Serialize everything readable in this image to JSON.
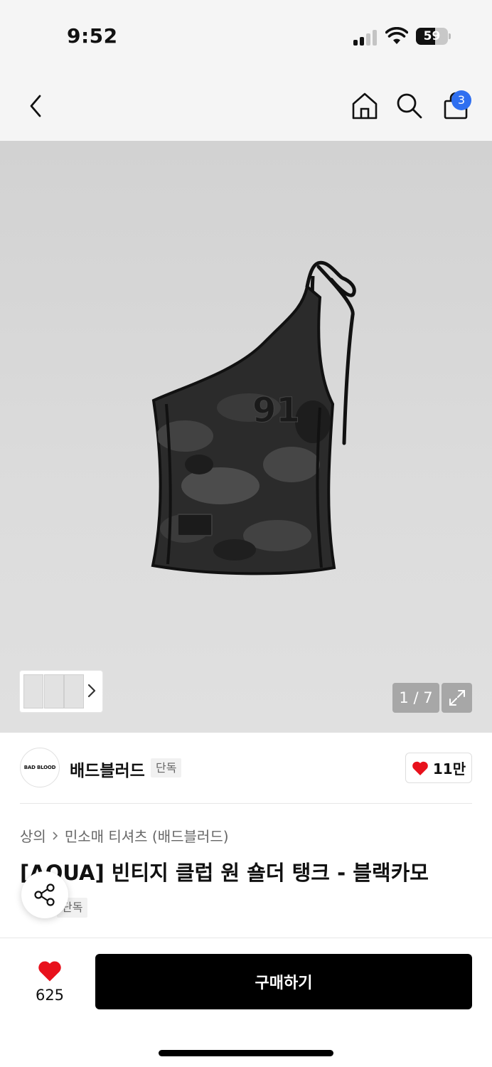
{
  "status": {
    "time": "9:52",
    "battery": "59",
    "battery_level": 0.59
  },
  "nav": {
    "cart_count": "3"
  },
  "gallery": {
    "counter": "1 / 7"
  },
  "brand": {
    "logo_text": "BAD BLOOD",
    "name": "배드블러드",
    "tag": "단독",
    "likes": "11만"
  },
  "product": {
    "category": "상의",
    "subcategory": "민소매 티셔츠 (배드블러드)",
    "title": "[AQUA] 빈티지 클럽 원 숄더 탱크 - 블랙카모",
    "badge": "단독"
  },
  "bottom": {
    "wish_count": "625",
    "buy_label": "구매하기"
  },
  "colors": {
    "accent_badge": "#2f6ff0",
    "heart": "#e8111c",
    "buy_button": "#000000"
  }
}
